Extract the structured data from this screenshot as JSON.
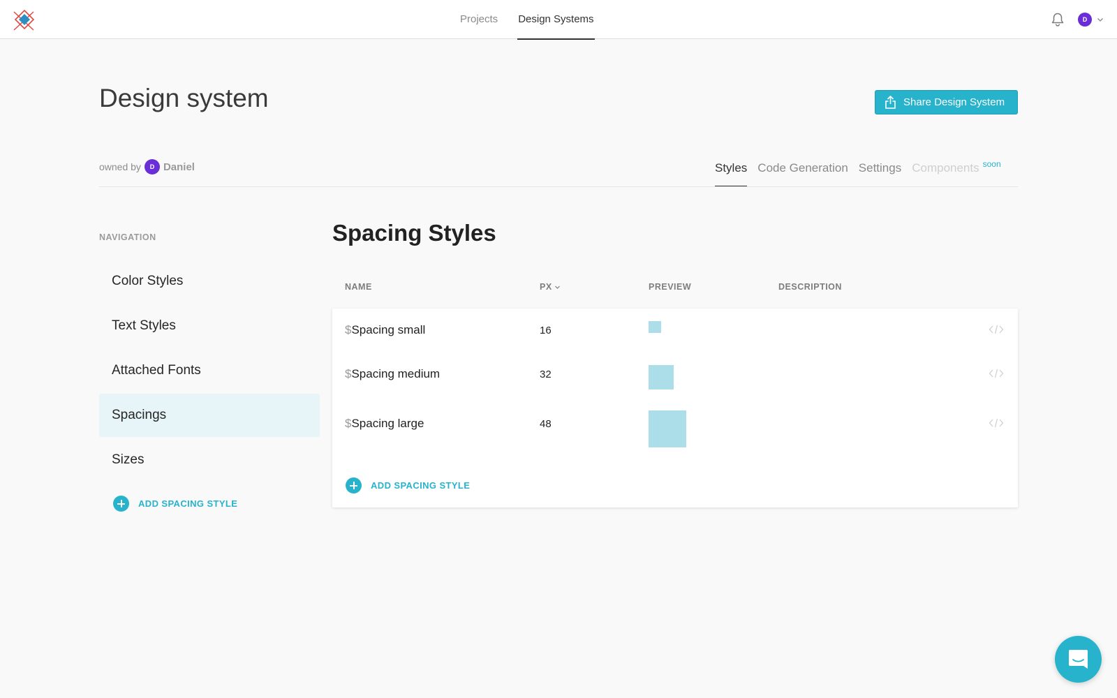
{
  "topnav": {
    "items": [
      {
        "label": "Projects",
        "active": false
      },
      {
        "label": "Design Systems",
        "active": true
      }
    ]
  },
  "user": {
    "initial": "D"
  },
  "header": {
    "title": "Design system",
    "share_label": "Share Design System",
    "owned_by_label": "owned by",
    "owner_initial": "D",
    "owner_name": "Daniel"
  },
  "subtabs": [
    {
      "label": "Styles",
      "active": true
    },
    {
      "label": "Code Generation",
      "active": false
    },
    {
      "label": "Settings",
      "active": false
    },
    {
      "label": "Components",
      "disabled": true,
      "badge": "soon"
    }
  ],
  "sidebar": {
    "label": "NAVIGATION",
    "items": [
      {
        "label": "Color Styles",
        "active": false
      },
      {
        "label": "Text Styles",
        "active": false
      },
      {
        "label": "Attached Fonts",
        "active": false
      },
      {
        "label": "Spacings",
        "active": true
      },
      {
        "label": "Sizes",
        "active": false
      }
    ],
    "add_label": "ADD SPACING STYLE"
  },
  "main": {
    "title": "Spacing Styles",
    "columns": {
      "name": "NAME",
      "px": "PX",
      "preview": "PREVIEW",
      "description": "DESCRIPTION"
    },
    "rows": [
      {
        "prefix": "$",
        "name": "Spacing small",
        "px": "16"
      },
      {
        "prefix": "$",
        "name": "Spacing medium",
        "px": "32"
      },
      {
        "prefix": "$",
        "name": "Spacing large",
        "px": "48"
      }
    ],
    "add_label": "ADD SPACING STYLE"
  },
  "colors": {
    "accent": "#27b3cc",
    "avatar": "#6a2ed8",
    "preview": "#acdeea",
    "active_nav_bg": "#e7f4f8"
  },
  "icons": [
    "logo-icon",
    "bell-icon",
    "chevron-down-icon",
    "share-icon",
    "plus-icon",
    "code-icon",
    "chat-icon"
  ]
}
